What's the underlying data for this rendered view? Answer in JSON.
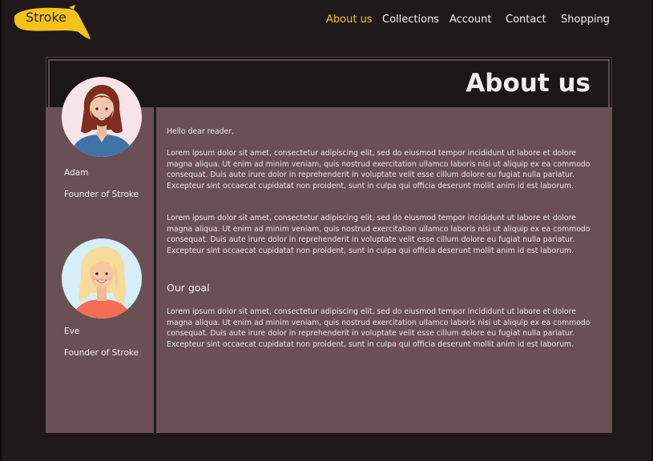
{
  "brand": {
    "logo_text": "Stroke",
    "accent_color": "#f3c21b"
  },
  "nav": {
    "items": [
      {
        "label": "About us",
        "active": true
      },
      {
        "label": "Collections",
        "active": false
      },
      {
        "label": "Account",
        "active": false
      },
      {
        "label": "Contact",
        "active": false
      },
      {
        "label": "Shopping",
        "active": false
      }
    ]
  },
  "page": {
    "title": "About us"
  },
  "team": [
    {
      "name": "Adam",
      "role": "Founder of Stroke",
      "avatar_icon": "man-with-beard-avatar"
    },
    {
      "name": "Eve",
      "role": "Founder of Stroke",
      "avatar_icon": "blonde-woman-avatar"
    }
  ],
  "content": {
    "greeting": "Hello dear reader,",
    "paragraph_1": "Lorem ipsum dolor sit amet, consectetur adipiscing elit, sed do eiusmod tempor incididunt ut labore et dolore magna aliqua. Ut enim ad minim veniam, quis nostrud exercitation ullamco laboris nisi ut aliquip ex ea commodo consequat. Duis aute irure dolor in reprehenderit in voluptate velit esse cillum dolore eu fugiat nulla pariatur. Excepteur sint occaecat cupidatat non proident, sunt in culpa qui officia deserunt mollit anim id est laborum.",
    "paragraph_2": "Lorem ipsum dolor sit amet, consectetur adipiscing elit, sed do eiusmod tempor incididunt ut labore et dolore magna aliqua. Ut enim ad minim veniam, quis nostrud exercitation ullamco laboris nisi ut aliquip ex ea commodo consequat. Duis aute irure dolor in reprehenderit in voluptate velit esse cillum dolore eu fugiat nulla pariatur. Excepteur sint occaecat cupidatat non proident, sunt in culpa qui officia deserunt mollit anim id est laborum.",
    "goal_heading": "Our goal",
    "paragraph_3": "Lorem ipsum dolor sit amet, consectetur adipiscing elit, sed do eiusmod tempor incididunt ut labore et dolore magna aliqua. Ut enim ad minim veniam, quis nostrud exercitation ullamco laboris nisi ut aliquip ex ea commodo consequat. Duis aute irure dolor in reprehenderit in voluptate velit esse cillum dolore eu fugiat nulla pariatur. Excepteur sint occaecat cupidatat non proident, sunt in culpa qui officia deserunt mollit anim id est laborum."
  }
}
